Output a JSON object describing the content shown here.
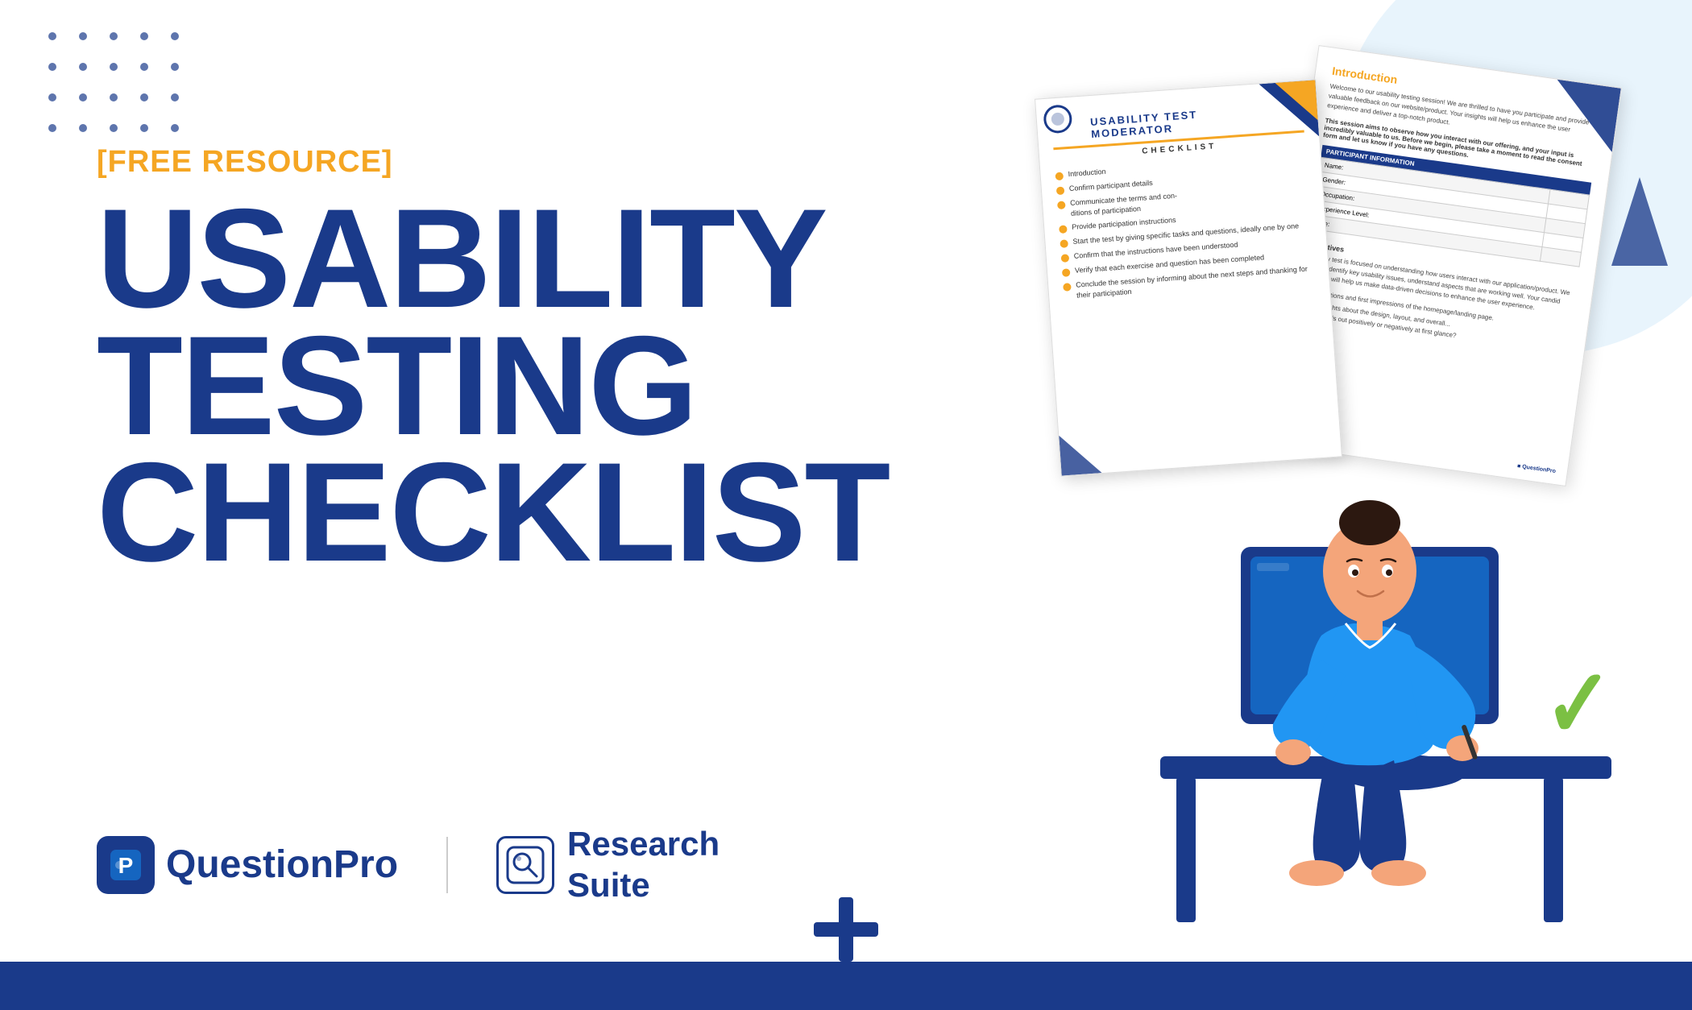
{
  "page": {
    "background_color": "#ffffff",
    "bottom_bar_color": "#1a3a8a"
  },
  "badge": {
    "text": "[FREE RESOURCE]",
    "color": "#f5a623"
  },
  "title": {
    "line1": "USABILITY",
    "line2": "TESTING",
    "line3": "CHECKLIST",
    "color": "#1a3a8a"
  },
  "logos": {
    "questionpro": {
      "icon_label": "P",
      "text": "QuestionPro"
    },
    "research_suite": {
      "text_line1": "Research",
      "text_line2": "Suite"
    }
  },
  "document": {
    "title_line1": "USABILITY TEST",
    "title_line2": "MODERATOR",
    "checklist_label": "CHECKLIST",
    "items": [
      "Introduction",
      "Confirm participant details",
      "Communicate the terms and conditions of participation",
      "Provide participation instructions",
      "Start the test by giving specific tasks and questions, ideally one by one",
      "Confirm that the instructions have been understood",
      "Verify that each exercise and question has been completed",
      "Conclude the session by informing about the next steps and thanking for their participation"
    ],
    "intro": {
      "title": "Introduction",
      "body": "Welcome to our usability testing session! We are thrilled to have you participate and provide valuable feedback on our website/product. Your insights will help us enhance the user experience and deliver a top-notch product."
    },
    "participant_fields": [
      "Name:",
      "Gender:",
      "Occupation:",
      "Experience Level:",
      "Age:"
    ]
  },
  "checkmark": {
    "symbol": "✓",
    "color": "#7bc043"
  },
  "plus": {
    "color": "#1a3a8a"
  }
}
